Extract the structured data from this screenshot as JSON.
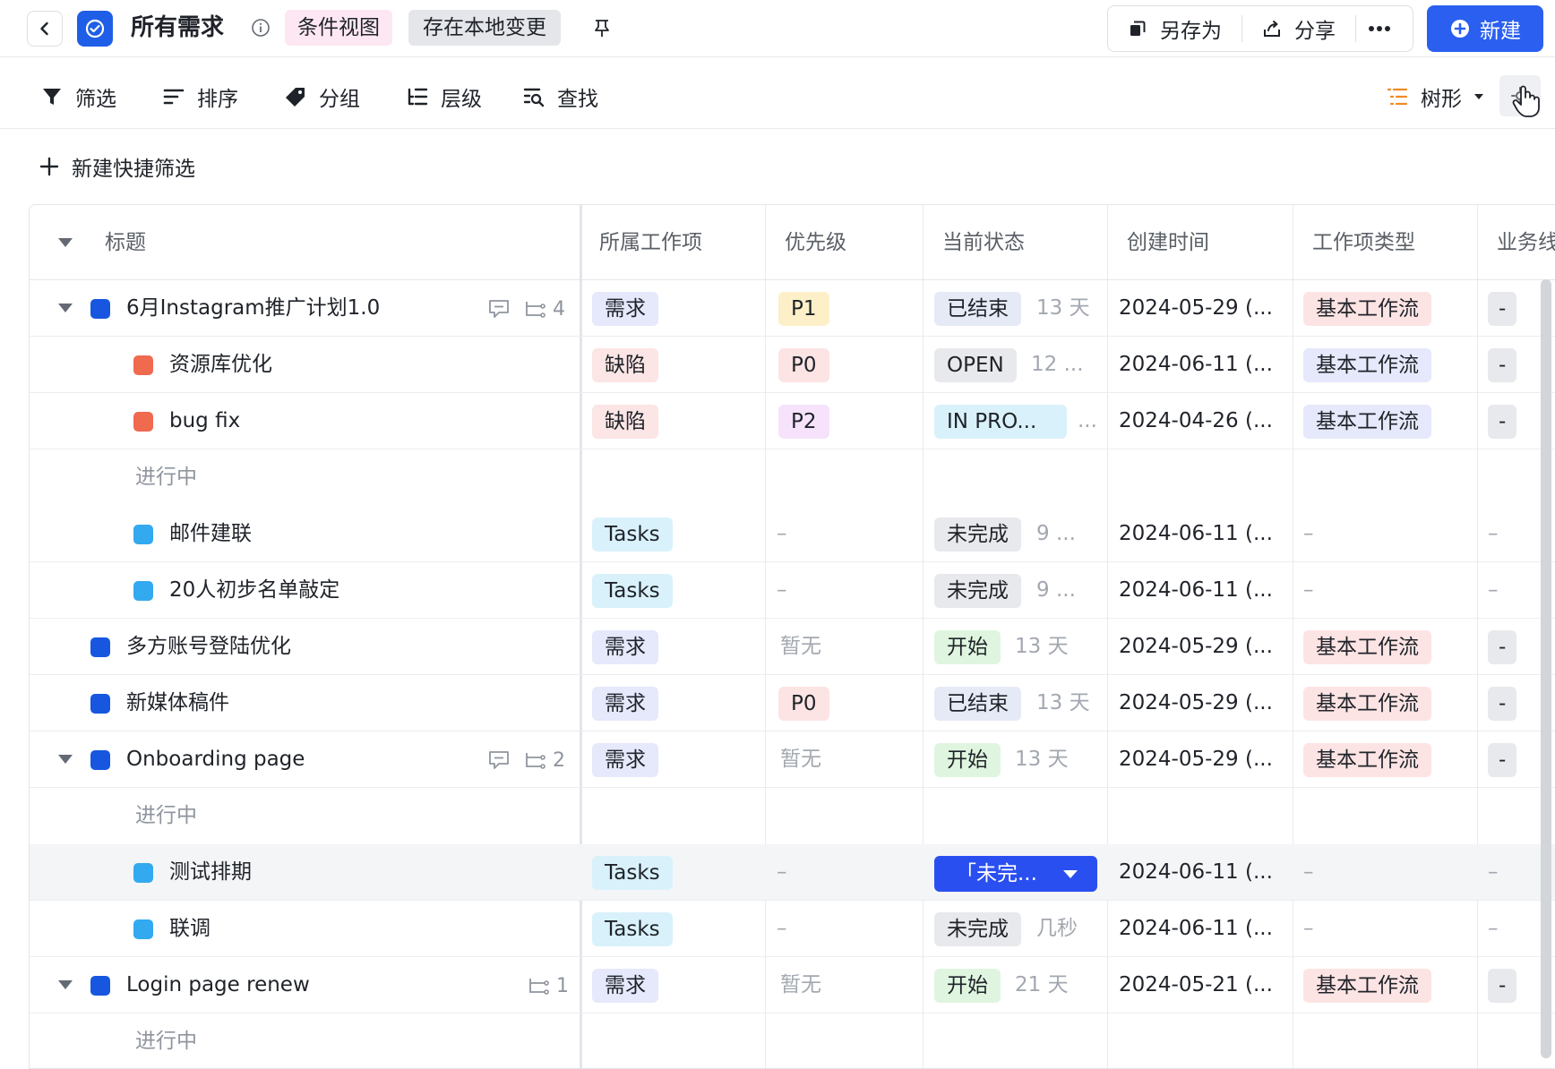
{
  "header": {
    "title": "所有需求",
    "view_chip": "条件视图",
    "local_chip": "存在本地变更",
    "save_as_label": "另存为",
    "share_label": "分享",
    "more_label": "•••",
    "new_label": "新建"
  },
  "toolbar": {
    "filter_label": "筛选",
    "sort_label": "排序",
    "group_label": "分组",
    "level_label": "层级",
    "find_label": "查找",
    "view_mode_label": "树形"
  },
  "quick_filter_label": "新建快捷筛选",
  "table": {
    "columns": [
      "标题",
      "所属工作项",
      "优先级",
      "当前状态",
      "创建时间",
      "工作项类型",
      "业务线"
    ],
    "rows": [
      {
        "title": "6月Instagram推广计划1.0",
        "sub_count": "4",
        "item": "需求",
        "priority": "P1",
        "status": "已结束",
        "age": "13 天",
        "created": "2024-05-29 (...",
        "type": "基本工作流",
        "biz": "-"
      },
      {
        "title": "资源库优化",
        "item": "缺陷",
        "priority": "P0",
        "status": "OPEN",
        "age": "12 ...",
        "created": "2024-06-11 (...",
        "type": "基本工作流",
        "biz": "-"
      },
      {
        "title": "bug fix",
        "item": "缺陷",
        "priority": "P2",
        "status": "IN PRO...",
        "age": "...",
        "created": "2024-04-26 (...",
        "type": "基本工作流",
        "biz": "-"
      },
      {
        "group": "进行中"
      },
      {
        "title": "邮件建联",
        "item": "Tasks",
        "priority": "–",
        "status": "未完成",
        "age": "9 ...",
        "created": "2024-06-11 (...",
        "type": "–",
        "biz": "–"
      },
      {
        "title": "20人初步名单敲定",
        "item": "Tasks",
        "priority": "–",
        "status": "未完成",
        "age": "9 ...",
        "created": "2024-06-11 (...",
        "type": "–",
        "biz": "–"
      },
      {
        "title": "多方账号登陆优化",
        "item": "需求",
        "priority": "暂无",
        "status": "开始",
        "age": "13 天",
        "created": "2024-05-29 (...",
        "type": "基本工作流",
        "biz": "-"
      },
      {
        "title": "新媒体稿件",
        "item": "需求",
        "priority": "P0",
        "status": "已结束",
        "age": "13 天",
        "created": "2024-05-29 (...",
        "type": "基本工作流",
        "biz": "-"
      },
      {
        "title": "Onboarding page",
        "sub_count": "2",
        "item": "需求",
        "priority": "暂无",
        "status": "开始",
        "age": "13 天",
        "created": "2024-05-29 (...",
        "type": "基本工作流",
        "biz": "-"
      },
      {
        "group": "进行中"
      },
      {
        "title": "测试排期",
        "item": "Tasks",
        "priority": "–",
        "status": "「未完...",
        "created": "2024-06-11 (...",
        "type": "–",
        "biz": "–"
      },
      {
        "title": "联调",
        "item": "Tasks",
        "priority": "–",
        "status": "未完成",
        "age": "几秒",
        "created": "2024-06-11 (...",
        "type": "–",
        "biz": "–"
      },
      {
        "title": "Login page renew",
        "sub_count": "1",
        "item": "需求",
        "priority": "暂无",
        "status": "开始",
        "age": "21 天",
        "created": "2024-05-21 (...",
        "type": "基本工作流",
        "biz": "-"
      },
      {
        "group": "进行中"
      }
    ]
  },
  "colors": {
    "accent": "#2a5ff0",
    "brand_blue": "#1757e0"
  }
}
